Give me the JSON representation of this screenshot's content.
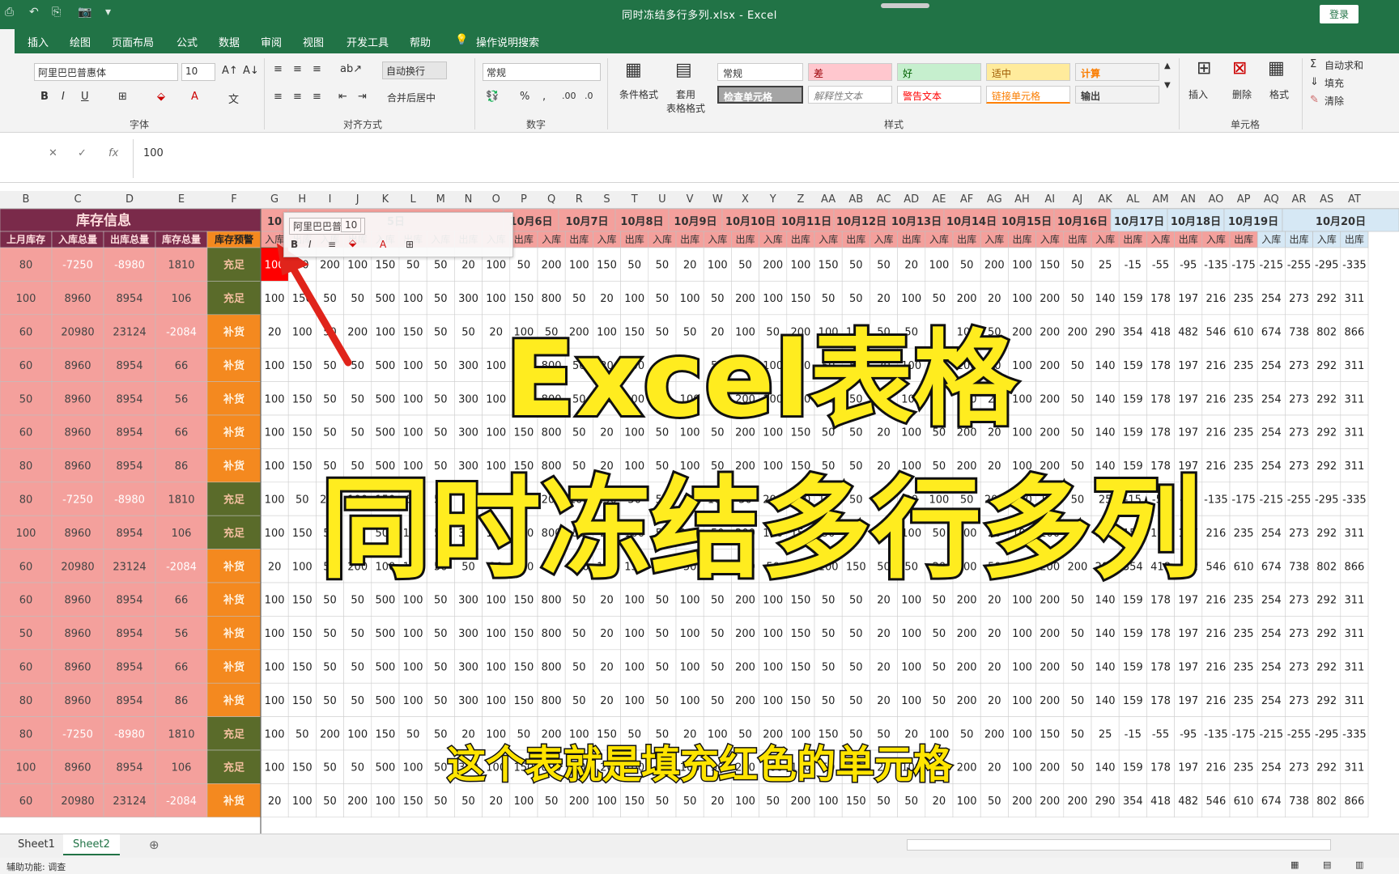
{
  "titlebar": {
    "title": "同时冻结多行多列.xlsx  -  Excel",
    "login": "登录"
  },
  "menu": [
    "插入",
    "绘图",
    "页面布局",
    "公式",
    "数据",
    "审阅",
    "视图",
    "开发工具",
    "帮助",
    "操作说明搜索"
  ],
  "ribbon": {
    "font_name": "阿里巴巴普惠体",
    "font_size": "10",
    "wrap_text": "自动换行",
    "merge_center": "合并后居中",
    "number_format": "常规",
    "conditional_format": "条件格式",
    "table_format": "套用\n表格格式",
    "styles": {
      "normal": "常规",
      "bad": "差",
      "good": "好",
      "neutral": "适中",
      "calc": "计算",
      "check_cell": "检查单元格",
      "explanatory": "解释性文本",
      "warning": "警告文本",
      "linked": "链接单元格",
      "output": "输出"
    },
    "insert": "插入",
    "delete": "删除",
    "format": "格式",
    "autosum": "自动求和",
    "fill": "填充",
    "clear": "清除",
    "groups": {
      "font": "字体",
      "align": "对齐方式",
      "number": "数字",
      "styles": "样式",
      "cells": "单元格"
    }
  },
  "formula_bar": {
    "value": "100"
  },
  "columns": [
    "B",
    "C",
    "D",
    "E",
    "F",
    "G",
    "H",
    "I",
    "J",
    "K",
    "L",
    "M",
    "N",
    "O",
    "P",
    "Q",
    "R",
    "S",
    "T",
    "U",
    "V",
    "W",
    "X",
    "Y",
    "Z",
    "AA",
    "AB",
    "AC",
    "AD",
    "AE",
    "AF",
    "AG",
    "AH",
    "AI",
    "AJ",
    "AK",
    "AL",
    "AM",
    "AN",
    "AO",
    "AP",
    "AQ",
    "AR",
    "AS",
    "AT"
  ],
  "table": {
    "section_title": "库存信息",
    "headers": [
      "上月库存",
      "入库总量",
      "出库总量",
      "库存总量",
      "库存预警"
    ],
    "date_headers": [
      "10",
      "5日",
      "10月6日",
      "10月7日",
      "10月8日",
      "10月9日",
      "10月10日",
      "10月11日",
      "10月12日",
      "10月13日",
      "10月14日",
      "10月15日",
      "10月16日",
      "10月17日",
      "10月18日",
      "10月19日",
      "10月20日"
    ],
    "in_label": "入库",
    "out_label": "出库",
    "rows": [
      {
        "b": "80",
        "c": "-7250",
        "d": "-8980",
        "e": "1810",
        "f": "充足",
        "vals": [
          "100",
          "50",
          "200",
          "100",
          "150",
          "50",
          "50",
          "20",
          "100",
          "50",
          "200",
          "100",
          "150",
          "50",
          "50",
          "20",
          "100",
          "50",
          "200",
          "100",
          "150",
          "50",
          "50",
          "20",
          "100",
          "50",
          "200",
          "100",
          "150",
          "50",
          "25",
          "-15",
          "-55",
          "-95",
          "-135",
          "-175",
          "-215",
          "-255",
          "-295",
          "-335"
        ]
      },
      {
        "b": "100",
        "c": "8960",
        "d": "8954",
        "e": "106",
        "f": "充足",
        "vals": [
          "100",
          "150",
          "50",
          "50",
          "500",
          "100",
          "50",
          "300",
          "100",
          "150",
          "800",
          "50",
          "20",
          "100",
          "50",
          "100",
          "50",
          "200",
          "100",
          "150",
          "50",
          "50",
          "20",
          "100",
          "50",
          "200",
          "20",
          "100",
          "200",
          "50",
          "140",
          "159",
          "178",
          "197",
          "216",
          "235",
          "254",
          "273",
          "292",
          "311"
        ]
      },
      {
        "b": "60",
        "c": "20980",
        "d": "23124",
        "e": "-2084",
        "f": "补货",
        "vals": [
          "20",
          "100",
          "50",
          "200",
          "100",
          "150",
          "50",
          "50",
          "20",
          "100",
          "50",
          "200",
          "100",
          "150",
          "50",
          "50",
          "20",
          "100",
          "50",
          "200",
          "100",
          "150",
          "50",
          "50",
          "20",
          "100",
          "50",
          "200",
          "200",
          "200",
          "290",
          "354",
          "418",
          "482",
          "546",
          "610",
          "674",
          "738",
          "802",
          "866"
        ]
      },
      {
        "b": "60",
        "c": "8960",
        "d": "8954",
        "e": "66",
        "f": "补货",
        "vals": [
          "100",
          "150",
          "50",
          "50",
          "500",
          "100",
          "50",
          "300",
          "100",
          "150",
          "800",
          "50",
          "20",
          "100",
          "50",
          "100",
          "50",
          "200",
          "100",
          "150",
          "50",
          "50",
          "20",
          "100",
          "50",
          "200",
          "20",
          "100",
          "200",
          "50",
          "140",
          "159",
          "178",
          "197",
          "216",
          "235",
          "254",
          "273",
          "292",
          "311"
        ]
      },
      {
        "b": "50",
        "c": "8960",
        "d": "8954",
        "e": "56",
        "f": "补货",
        "vals": [
          "100",
          "150",
          "50",
          "50",
          "500",
          "100",
          "50",
          "300",
          "100",
          "150",
          "800",
          "50",
          "20",
          "100",
          "50",
          "100",
          "50",
          "200",
          "100",
          "150",
          "50",
          "50",
          "20",
          "100",
          "50",
          "200",
          "20",
          "100",
          "200",
          "50",
          "140",
          "159",
          "178",
          "197",
          "216",
          "235",
          "254",
          "273",
          "292",
          "311"
        ]
      },
      {
        "b": "60",
        "c": "8960",
        "d": "8954",
        "e": "66",
        "f": "补货",
        "vals": [
          "100",
          "150",
          "50",
          "50",
          "500",
          "100",
          "50",
          "300",
          "100",
          "150",
          "800",
          "50",
          "20",
          "100",
          "50",
          "100",
          "50",
          "200",
          "100",
          "150",
          "50",
          "50",
          "20",
          "100",
          "50",
          "200",
          "20",
          "100",
          "200",
          "50",
          "140",
          "159",
          "178",
          "197",
          "216",
          "235",
          "254",
          "273",
          "292",
          "311"
        ]
      },
      {
        "b": "80",
        "c": "8960",
        "d": "8954",
        "e": "86",
        "f": "补货",
        "vals": [
          "100",
          "150",
          "50",
          "50",
          "500",
          "100",
          "50",
          "300",
          "100",
          "150",
          "800",
          "50",
          "20",
          "100",
          "50",
          "100",
          "50",
          "200",
          "100",
          "150",
          "50",
          "50",
          "20",
          "100",
          "50",
          "200",
          "20",
          "100",
          "200",
          "50",
          "140",
          "159",
          "178",
          "197",
          "216",
          "235",
          "254",
          "273",
          "292",
          "311"
        ]
      },
      {
        "b": "80",
        "c": "-7250",
        "d": "-8980",
        "e": "1810",
        "f": "充足",
        "vals": [
          "100",
          "50",
          "200",
          "100",
          "150",
          "50",
          "50",
          "20",
          "100",
          "50",
          "200",
          "100",
          "150",
          "50",
          "50",
          "20",
          "100",
          "50",
          "200",
          "100",
          "150",
          "50",
          "50",
          "20",
          "100",
          "50",
          "200",
          "100",
          "150",
          "50",
          "25",
          "-15",
          "-55",
          "-95",
          "-135",
          "-175",
          "-215",
          "-255",
          "-295",
          "-335"
        ]
      },
      {
        "b": "100",
        "c": "8960",
        "d": "8954",
        "e": "106",
        "f": "充足",
        "vals": [
          "100",
          "150",
          "50",
          "50",
          "500",
          "100",
          "50",
          "300",
          "100",
          "150",
          "800",
          "50",
          "20",
          "100",
          "50",
          "100",
          "50",
          "200",
          "100",
          "150",
          "50",
          "50",
          "20",
          "100",
          "50",
          "200",
          "20",
          "100",
          "200",
          "50",
          "140",
          "159",
          "178",
          "197",
          "216",
          "235",
          "254",
          "273",
          "292",
          "311"
        ]
      },
      {
        "b": "60",
        "c": "20980",
        "d": "23124",
        "e": "-2084",
        "f": "补货",
        "vals": [
          "20",
          "100",
          "50",
          "200",
          "100",
          "150",
          "50",
          "50",
          "20",
          "100",
          "50",
          "200",
          "100",
          "150",
          "50",
          "50",
          "20",
          "100",
          "50",
          "200",
          "100",
          "150",
          "50",
          "50",
          "20",
          "100",
          "50",
          "200",
          "200",
          "200",
          "290",
          "354",
          "418",
          "482",
          "546",
          "610",
          "674",
          "738",
          "802",
          "866"
        ]
      },
      {
        "b": "60",
        "c": "8960",
        "d": "8954",
        "e": "66",
        "f": "补货",
        "vals": [
          "100",
          "150",
          "50",
          "50",
          "500",
          "100",
          "50",
          "300",
          "100",
          "150",
          "800",
          "50",
          "20",
          "100",
          "50",
          "100",
          "50",
          "200",
          "100",
          "150",
          "50",
          "50",
          "20",
          "100",
          "50",
          "200",
          "20",
          "100",
          "200",
          "50",
          "140",
          "159",
          "178",
          "197",
          "216",
          "235",
          "254",
          "273",
          "292",
          "311"
        ]
      },
      {
        "b": "50",
        "c": "8960",
        "d": "8954",
        "e": "56",
        "f": "补货",
        "vals": [
          "100",
          "150",
          "50",
          "50",
          "500",
          "100",
          "50",
          "300",
          "100",
          "150",
          "800",
          "50",
          "20",
          "100",
          "50",
          "100",
          "50",
          "200",
          "100",
          "150",
          "50",
          "50",
          "20",
          "100",
          "50",
          "200",
          "20",
          "100",
          "200",
          "50",
          "140",
          "159",
          "178",
          "197",
          "216",
          "235",
          "254",
          "273",
          "292",
          "311"
        ]
      },
      {
        "b": "60",
        "c": "8960",
        "d": "8954",
        "e": "66",
        "f": "补货",
        "vals": [
          "100",
          "150",
          "50",
          "50",
          "500",
          "100",
          "50",
          "300",
          "100",
          "150",
          "800",
          "50",
          "20",
          "100",
          "50",
          "100",
          "50",
          "200",
          "100",
          "150",
          "50",
          "50",
          "20",
          "100",
          "50",
          "200",
          "20",
          "100",
          "200",
          "50",
          "140",
          "159",
          "178",
          "197",
          "216",
          "235",
          "254",
          "273",
          "292",
          "311"
        ]
      },
      {
        "b": "80",
        "c": "8960",
        "d": "8954",
        "e": "86",
        "f": "补货",
        "vals": [
          "100",
          "150",
          "50",
          "50",
          "500",
          "100",
          "50",
          "300",
          "100",
          "150",
          "800",
          "50",
          "20",
          "100",
          "50",
          "100",
          "50",
          "200",
          "100",
          "150",
          "50",
          "50",
          "20",
          "100",
          "50",
          "200",
          "20",
          "100",
          "200",
          "50",
          "140",
          "159",
          "178",
          "197",
          "216",
          "235",
          "254",
          "273",
          "292",
          "311"
        ]
      },
      {
        "b": "80",
        "c": "-7250",
        "d": "-8980",
        "e": "1810",
        "f": "充足",
        "vals": [
          "100",
          "50",
          "200",
          "100",
          "150",
          "50",
          "50",
          "20",
          "100",
          "50",
          "200",
          "100",
          "150",
          "50",
          "50",
          "20",
          "100",
          "50",
          "200",
          "100",
          "150",
          "50",
          "50",
          "20",
          "100",
          "50",
          "200",
          "100",
          "150",
          "50",
          "25",
          "-15",
          "-55",
          "-95",
          "-135",
          "-175",
          "-215",
          "-255",
          "-295",
          "-335"
        ]
      },
      {
        "b": "100",
        "c": "8960",
        "d": "8954",
        "e": "106",
        "f": "充足",
        "vals": [
          "100",
          "150",
          "50",
          "50",
          "500",
          "100",
          "50",
          "300",
          "100",
          "150",
          "800",
          "50",
          "20",
          "100",
          "50",
          "100",
          "50",
          "200",
          "100",
          "150",
          "50",
          "50",
          "20",
          "100",
          "50",
          "200",
          "20",
          "100",
          "200",
          "50",
          "140",
          "159",
          "178",
          "197",
          "216",
          "235",
          "254",
          "273",
          "292",
          "311"
        ]
      },
      {
        "b": "60",
        "c": "20980",
        "d": "23124",
        "e": "-2084",
        "f": "补货",
        "vals": [
          "20",
          "100",
          "50",
          "200",
          "100",
          "150",
          "50",
          "50",
          "20",
          "100",
          "50",
          "200",
          "100",
          "150",
          "50",
          "50",
          "20",
          "100",
          "50",
          "200",
          "100",
          "150",
          "50",
          "50",
          "20",
          "100",
          "50",
          "200",
          "200",
          "200",
          "290",
          "354",
          "418",
          "482",
          "546",
          "610",
          "674",
          "738",
          "802",
          "866"
        ]
      }
    ]
  },
  "colors": {
    "excel_green": "#217346",
    "frozen_bg": "#f4a09c",
    "title_bg": "#7a2a4a",
    "sufficient": "#5a6b2a",
    "restock": "#f4891f",
    "selected": "#ff0000",
    "date_pink": "#f4a09c",
    "date_blue": "#d6e8f5",
    "overlay_yellow": "#ffec1f"
  },
  "overlay": {
    "line1": "Excel表格",
    "line2": "同时冻结多行多列",
    "subtitle": "这个表就是填充红色的单元格"
  },
  "sheets": [
    "Sheet1",
    "Sheet2"
  ],
  "status": "辅助功能: 调查"
}
